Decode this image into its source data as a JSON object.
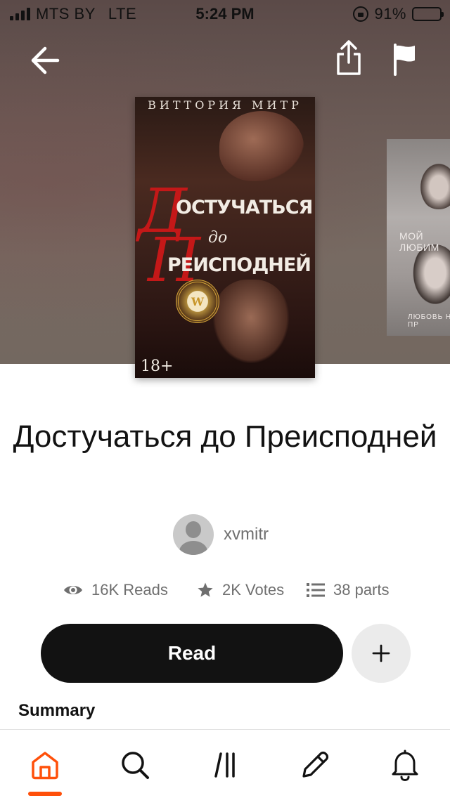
{
  "status_bar": {
    "carrier": "MTS BY",
    "network": "LTE",
    "time": "5:24 PM",
    "battery_percent": "91%",
    "battery_level": 0.91
  },
  "cover": {
    "author_line": "ВИТТОРИЯ МИТР",
    "title_line1": "ОСТУЧАТЬСЯ",
    "title_line2": "до",
    "title_line3": "РЕИСПОДНЕЙ",
    "initial_d": "Д",
    "initial_p": "П",
    "badge": "W",
    "age_rating": "18+"
  },
  "side_cover": {
    "text1": "МОЙ ЛЮБИМ",
    "text2": "ЛЮБОВЬ НА ПР"
  },
  "book": {
    "title": "Достучаться до Преисподней",
    "author": "xvmitr"
  },
  "stats": {
    "reads": "16K Reads",
    "votes": "2K Votes",
    "parts": "38 parts"
  },
  "actions": {
    "read_label": "Read",
    "add_label": "+"
  },
  "summary_heading": "Summary",
  "colors": {
    "accent": "#ff500a",
    "primary_button": "#121212",
    "secondary_button": "#ebebeb",
    "muted_text": "#6f6f6f"
  },
  "icons": {
    "back": "arrow-left-icon",
    "share": "share-icon",
    "report": "flag-icon",
    "reads": "eye-icon",
    "votes": "star-icon",
    "parts": "list-icon",
    "add": "plus-icon",
    "home": "home-icon",
    "search": "search-icon",
    "library": "library-icon",
    "write": "pencil-icon",
    "notifications": "bell-icon"
  },
  "tabs": [
    "home",
    "search",
    "library",
    "write",
    "notifications"
  ],
  "active_tab": "home"
}
